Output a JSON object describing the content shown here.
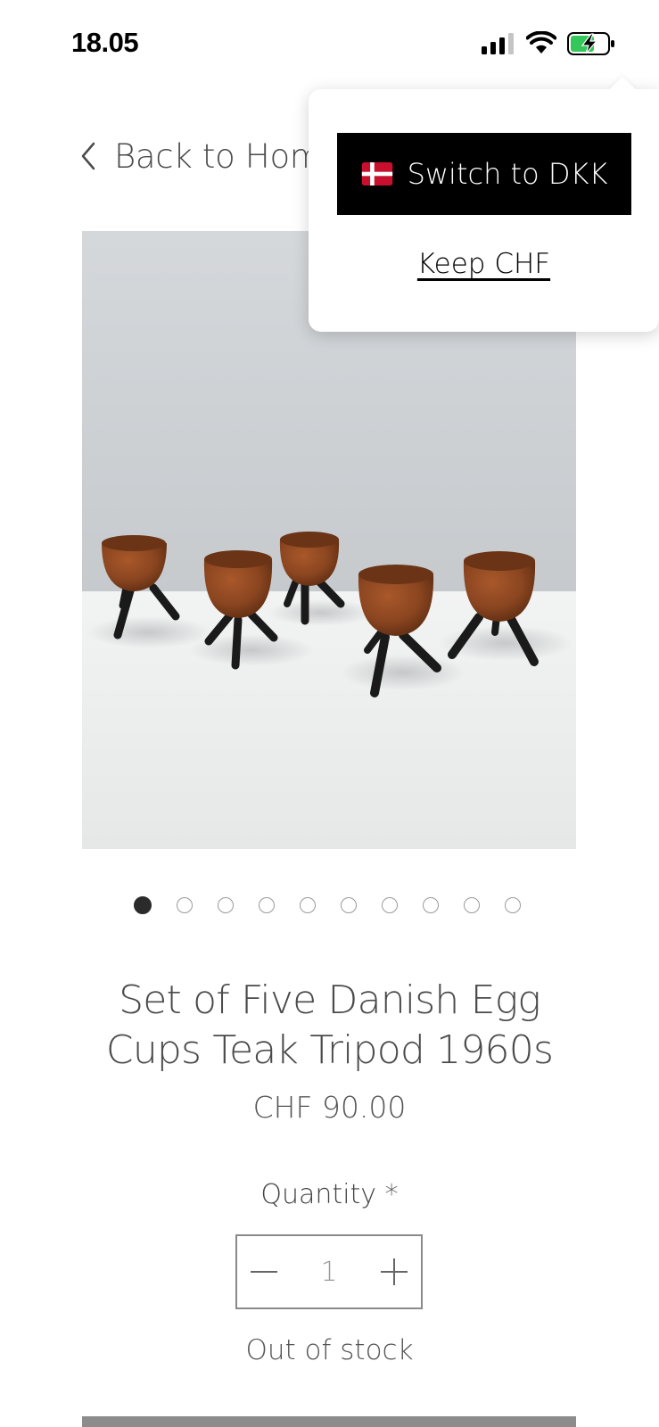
{
  "status_bar": {
    "time": "18.05",
    "icons": [
      "signal-icon",
      "wifi-icon",
      "battery-charging-icon"
    ]
  },
  "navigation": {
    "back_label": "Back to Home"
  },
  "product": {
    "image_icon": "product-photo",
    "title": "Set of Five Danish Egg Cups Teak Tripod 1960s",
    "price": "CHF 90.00"
  },
  "carousel": {
    "total": 10,
    "active_index": 0
  },
  "quantity": {
    "label": "Quantity *",
    "value": "1",
    "decrement_icon": "minus-icon",
    "increment_icon": "plus-icon"
  },
  "stock_status": "Out of stock",
  "currency_popup": {
    "switch_label": "Switch to DKK",
    "switch_icon": "denmark-flag-icon",
    "keep_label": "Keep CHF"
  },
  "colors": {
    "primary_button": "#000000",
    "flag_red": "#C8102E",
    "battery_green": "#34C759"
  }
}
